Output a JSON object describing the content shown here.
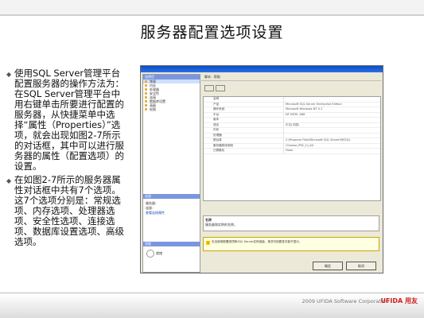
{
  "title": "服务器配置选项设置",
  "bullets": [
    "使用SQL Server管理平台配置服务器的操作方法为：在SQL Server管理平台中用右键单击所要进行配置的服务器，从快捷菜单中选择“属性（Properties）”选项，就会出现如图2-7所示的对话框，其中可以进行服务器的属性（配置选项）的设置。",
    "在如图2-7所示的服务器属性对话框中共有7个选项。这7个选项分别是：常规选项、内存选项、处理器选项、安全性选项、连接选项、数据库设置选项、高级选项。"
  ],
  "dialog": {
    "left_header": "选择页",
    "pages": [
      "常规",
      "内存",
      "处理器",
      "安全性",
      "连接",
      "数据库设置",
      "高级",
      "权限"
    ],
    "section_connection": "连接",
    "section_progress": "进度",
    "connection_items": [
      "服务器：",
      "连接：",
      "查看连接属性"
    ],
    "progress_label": "就绪",
    "toolbar_label": "脚本 · 帮助",
    "property_rows": [
      [
        "名称",
        ""
      ],
      [
        "产品",
        "Microsoft SQL Server Enterprise Edition"
      ],
      [
        "操作系统",
        "Microsoft Windows NT 5.1"
      ],
      [
        "平台",
        "NT INTEL X86"
      ],
      [
        "版本",
        ""
      ],
      [
        "语言",
        "中文(中国)"
      ],
      [
        "内存",
        ""
      ],
      [
        "处理器",
        ""
      ],
      [
        "根目录",
        "C:\\Program Files\\Microsoft SQL Server\\MSSQL"
      ],
      [
        "服务器排序规则",
        "Chinese_PRC_CI_AS"
      ],
      [
        "已群集化",
        "False"
      ]
    ],
    "desc_title": "名称",
    "desc_text": "服务器和实例的名称。",
    "warning": "无法使用配置选项和SQL Server实例连接，某些可用属性可能不显示。",
    "ok_label": "确定",
    "cancel_label": "取消"
  },
  "footer": {
    "copyright": "2009 UFIDA Software Corporation",
    "logo_text": "UFIDA 用友"
  }
}
